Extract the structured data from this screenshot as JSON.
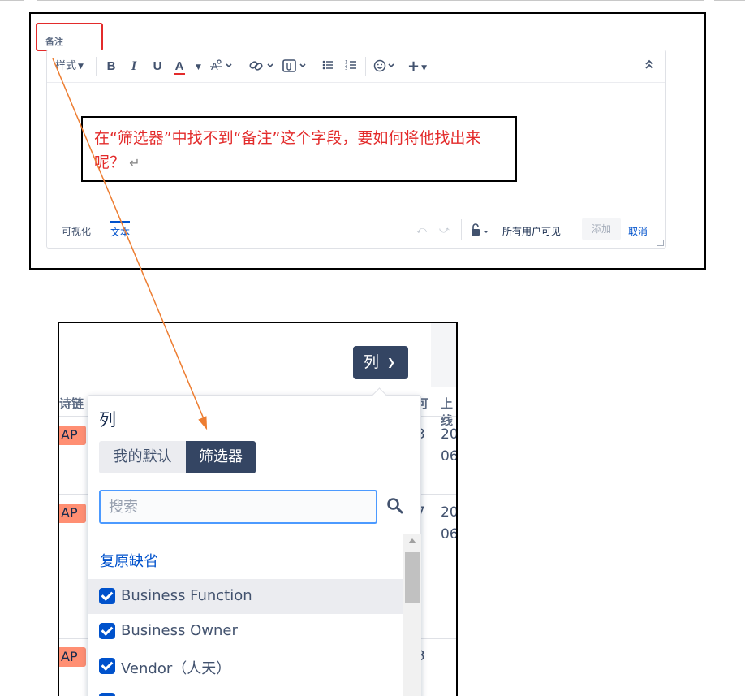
{
  "note_field": {
    "label": "备注"
  },
  "toolbar": {
    "style_label": "样式",
    "bold": "B",
    "italic": "I",
    "underline": "U",
    "text_color": "A",
    "clear_format": "A̷",
    "insert": "+"
  },
  "editor_footer": {
    "tab_visual": "可视化",
    "tab_text": "文本",
    "visibility": "所有用户可见",
    "add_button": "添加",
    "cancel_button": "取消"
  },
  "callout": {
    "text": "在“筛选器”中找不到“备注”这个字段，要如何将他找出来呢？"
  },
  "columns": {
    "button_label": "列",
    "popup_title": "列",
    "tabs": [
      {
        "label": "我的默认",
        "active": false
      },
      {
        "label": "筛选器",
        "active": true
      }
    ],
    "search_placeholder": "搜索",
    "reset_label": "复原缺省",
    "options": [
      {
        "label": "Business Function",
        "checked": true
      },
      {
        "label": "Business Owner",
        "checked": true
      },
      {
        "label": "Vendor（人天）",
        "checked": true
      }
    ]
  },
  "background_table": {
    "header_left": "诗链",
    "header_mid": "可",
    "header_right": "上线",
    "badges": [
      "AP",
      "AP",
      "AP"
    ],
    "col_mid": [
      "3",
      "7",
      "3"
    ],
    "col_right": [
      [
        "20",
        "06"
      ],
      [
        "20",
        "06"
      ]
    ]
  },
  "colors": {
    "accent_red": "#e32b2b",
    "primary_blue": "#0052cc",
    "button_dark": "#344563",
    "arrow_orange": "#ed7d31"
  }
}
